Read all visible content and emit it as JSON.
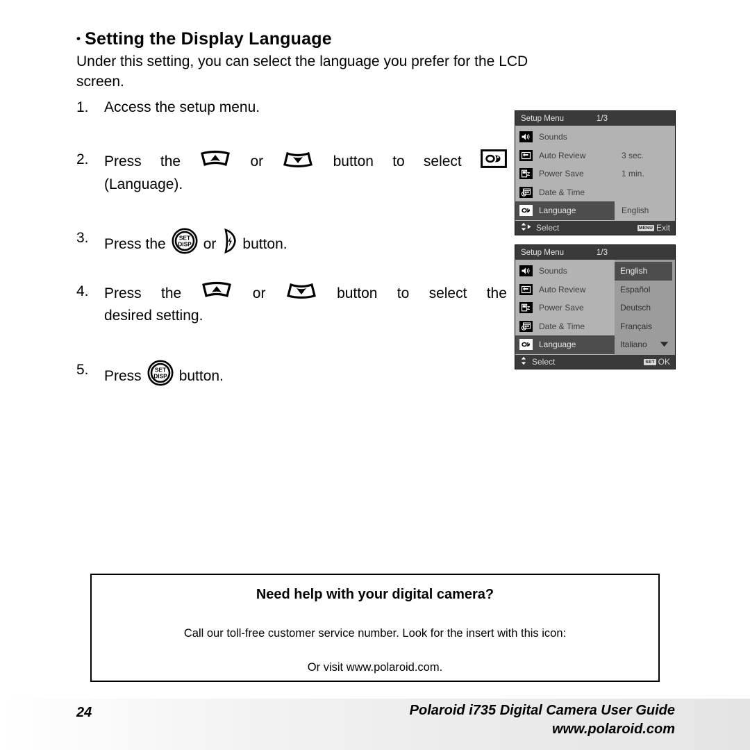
{
  "heading": {
    "bullet": "•",
    "text": "Setting the Display Language"
  },
  "intro": {
    "line1": "Under this setting, you can select the language you prefer for the LCD",
    "line2": "screen."
  },
  "steps": [
    {
      "num": "1.",
      "parts": [
        "Access the setup menu."
      ]
    },
    {
      "num": "2.",
      "pre": "Press",
      "the": "the",
      "or": "or",
      "mid": "button",
      "to": "to",
      "select": "select",
      "line2": "(Language)."
    },
    {
      "num": "3.",
      "pre": "Press the",
      "or": "or",
      "post": "button."
    },
    {
      "num": "4.",
      "pre": "Press",
      "the": "the",
      "or": "or",
      "mid": "button",
      "to": "to",
      "select": "select",
      "the2": "the",
      "line2": "desired setting."
    },
    {
      "num": "5.",
      "pre": "Press",
      "post": "button."
    }
  ],
  "lcd1": {
    "title": "Setup Menu",
    "page": "1/3",
    "items": [
      {
        "icon": "speaker-icon",
        "label": "Sounds",
        "value": ""
      },
      {
        "icon": "auto-review-icon",
        "label": "Auto Review",
        "value": "3 sec."
      },
      {
        "icon": "power-save-icon",
        "label": "Power Save",
        "value": "1 min."
      },
      {
        "icon": "date-time-icon",
        "label": "Date & Time",
        "value": ""
      },
      {
        "icon": "language-icon",
        "label": "Language",
        "value": "English"
      }
    ],
    "footer": {
      "left_label": "Select",
      "right_key": "MENU",
      "right_label": "Exit"
    }
  },
  "lcd2": {
    "title": "Setup Menu",
    "page": "1/3",
    "items": [
      {
        "icon": "speaker-icon",
        "label": "Sounds"
      },
      {
        "icon": "auto-review-icon",
        "label": "Auto Review"
      },
      {
        "icon": "power-save-icon",
        "label": "Power Save"
      },
      {
        "icon": "date-time-icon",
        "label": "Date & Time"
      },
      {
        "icon": "language-icon",
        "label": "Language"
      }
    ],
    "languages": [
      {
        "label": "English",
        "selected": true
      },
      {
        "label": "Español",
        "selected": false
      },
      {
        "label": "Deutsch",
        "selected": false
      },
      {
        "label": "Français",
        "selected": false
      },
      {
        "label": "Italiano",
        "selected": false
      }
    ],
    "footer": {
      "left_label": "Select",
      "right_key": "SET",
      "right_label": "OK"
    }
  },
  "help": {
    "title": "Need help with your digital camera?",
    "line1": "Call our toll-free customer service number. Look for the insert with this icon:",
    "line2": "Or visit www.polaroid.com."
  },
  "footer": {
    "page_number": "24",
    "guide": "Polaroid i735 Digital Camera User Guide",
    "site": "www.polaroid.com"
  },
  "button_labels": {
    "set": "SET",
    "disp": "DISP"
  }
}
